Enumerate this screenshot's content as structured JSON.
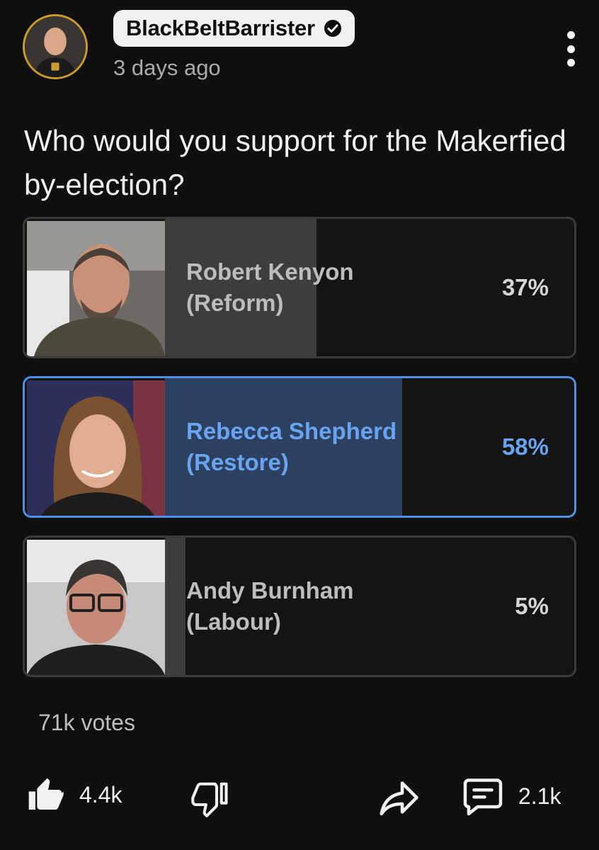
{
  "post": {
    "channel_name": "BlackBeltBarrister",
    "timestamp": "3 days ago",
    "question": "Who would you support for the Makerfied by-election?"
  },
  "poll": {
    "options": [
      {
        "name": "Robert Kenyon\n(Reform)",
        "percent_label": "37%",
        "percent": 37,
        "selected": false
      },
      {
        "name": "Rebecca Shepherd\n(Restore)",
        "percent_label": "58%",
        "percent": 58,
        "selected": true
      },
      {
        "name": "Andy Burnham\n(Labour)",
        "percent_label": "5%",
        "percent": 5,
        "selected": false
      }
    ],
    "votes": "71k votes"
  },
  "actions": {
    "likes": "4.4k",
    "comments": "2.1k"
  },
  "icons": {
    "verified": "verified-check-icon",
    "more": "vertical-ellipsis-icon",
    "like": "thumbs-up-filled-icon",
    "dislike": "thumbs-down-outline-icon",
    "share": "share-arrow-icon",
    "comment": "comment-bubble-icon"
  },
  "colors": {
    "background": "#0f0f0f",
    "selected_accent": "#67a4f2",
    "selected_border": "#4d90e6",
    "avatar_ring": "#c99a2e"
  }
}
